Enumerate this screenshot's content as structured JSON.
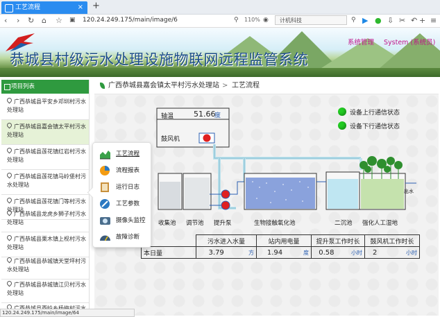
{
  "browser": {
    "tab_title": "工艺流程",
    "tab_close": "×",
    "new_tab": "+",
    "url": "120.24.249.175/main/image/6",
    "zoom": "110%",
    "search_text": "计机科技",
    "status_url": "120.24.249.175/main/image/64"
  },
  "header": {
    "title": "恭城县村级污水处理设施物联网远程监管系统",
    "system_manage": "系统管理",
    "user": "System (系统员)"
  },
  "sidebar": {
    "heading": "项目列表",
    "items": [
      {
        "label": "广西恭城县平安乡邓圳村污水处理站"
      },
      {
        "label": "广西恭城县嘉会镇太平村污水处理站"
      },
      {
        "label": "广西恭城县莲花镇红岩村污水处理站"
      },
      {
        "label": "广西恭城县莲花镇马岭堡村污水处理站"
      },
      {
        "label": "广西恭城县莲花镇门等村污水处理站"
      },
      {
        "label": "广西恭城县龙虎乡狮子村污水处理站"
      },
      {
        "label": "广西恭城县栗木镇上枧村污水处理站"
      },
      {
        "label": "广西恭城县恭城镇天堂坪村污水处理站"
      },
      {
        "label": "广西恭城县恭城镇江贝村污水处理站"
      },
      {
        "label": "广西恭城县西岭乡杨梅村污水处理站"
      }
    ]
  },
  "popup_menu": {
    "items": [
      {
        "label": "工艺流程",
        "icon": "chart-area-icon"
      },
      {
        "label": "流程报表",
        "icon": "pie-chart-icon"
      },
      {
        "label": "运行日志",
        "icon": "log-book-icon"
      },
      {
        "label": "工艺参数",
        "icon": "wrench-gear-icon"
      },
      {
        "label": "摄像头监控",
        "icon": "camera-icon"
      },
      {
        "label": "故障诊断",
        "icon": "gauge-icon"
      }
    ]
  },
  "breadcrumb": {
    "station": "广西恭城县嘉会镇太平村污水处理站",
    "separator": ">",
    "page": "工艺流程"
  },
  "process": {
    "temp_label": "轴温",
    "temp_value": "51.66",
    "temp_unit": "度",
    "blower_label": "鼓风机",
    "uplink_status": "设备上行通信状态",
    "downlink_status": "设备下行通信状态",
    "labels": {
      "collection_tank": "收集池",
      "adjust_tank": "调节池",
      "lift_pump": "提升泵",
      "bio_tank": "生物接触氧化池",
      "secondary_tank": "二沉池",
      "wetland": "强化人工湿地",
      "outlet": "出水"
    },
    "table": {
      "headers": [
        "污水进入水量",
        "站内用电量",
        "提升泵工作时长",
        "鼓风机工作时长"
      ],
      "row_label": "本日量",
      "values": [
        "3.79",
        "1.94",
        "0.58",
        "2"
      ],
      "units": [
        "方",
        "度",
        "小时",
        "小时"
      ]
    }
  },
  "colors": {
    "accent_green": "#2f9a3f",
    "status_green": "#22cc22",
    "title_blue": "#1d4f8a",
    "link_blue": "#2b5fb2",
    "magenta": "#c0148a"
  }
}
